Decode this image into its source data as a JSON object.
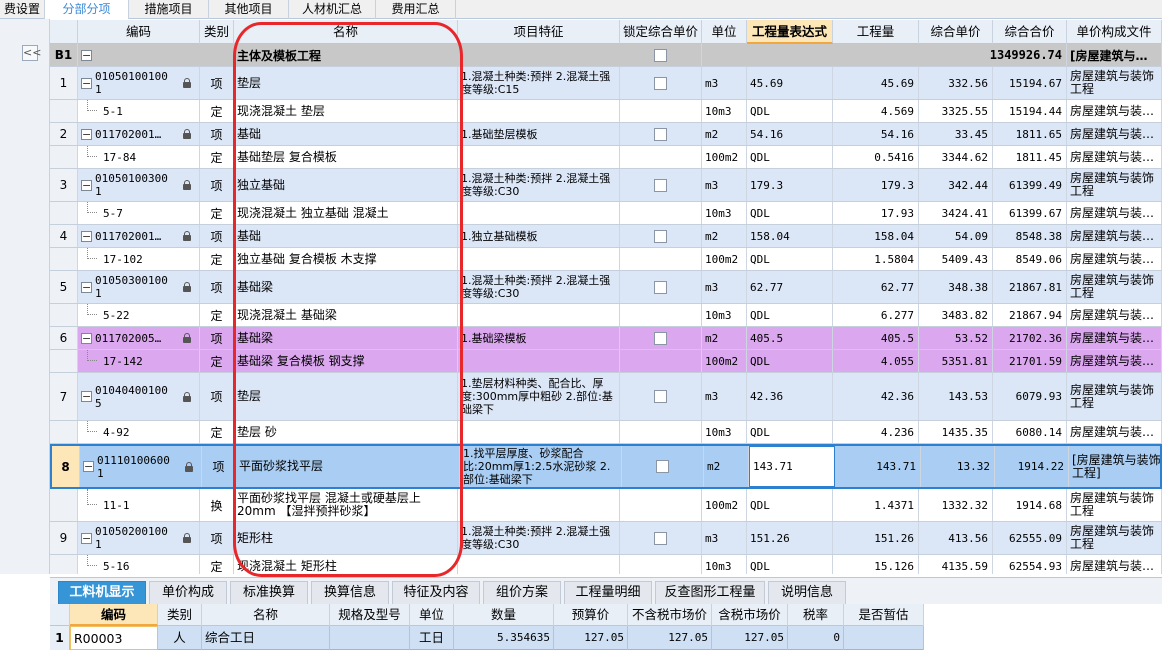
{
  "top_tabs": [
    {
      "label": "费设置",
      "active": false
    },
    {
      "label": "分部分项",
      "active": true
    },
    {
      "label": "措施项目",
      "active": false
    },
    {
      "label": "其他项目",
      "active": false
    },
    {
      "label": "人材机汇总",
      "active": false
    },
    {
      "label": "费用汇总",
      "active": false
    }
  ],
  "sidebar": {
    "collapse_label": "<<"
  },
  "columns": [
    "编码",
    "类别",
    "名称",
    "项目特征",
    "锁定综合单价",
    "单位",
    "工程量表达式",
    "工程量",
    "综合单价",
    "综合合价",
    "单价构成文件"
  ],
  "section": {
    "num": "B1",
    "name": "主体及模板工程",
    "total": "1349926.74",
    "file": "[房屋建筑与…"
  },
  "rows": [
    {
      "num": "1",
      "code": "01050100100 1",
      "type": "项",
      "name": "垫层",
      "feature": "1.混凝土种类:预拌 2.混凝土强度等级:C15",
      "unit": "m3",
      "expr": "45.69",
      "qty": "45.69",
      "price": "332.56",
      "total": "15194.67",
      "file": "房屋建筑与装饰工程"
    },
    {
      "num": "",
      "code": "5-1",
      "type": "定",
      "name": "现浇混凝土 垫层",
      "feature": "",
      "unit": "10m3",
      "expr": "QDL",
      "qty": "4.569",
      "price": "3325.55",
      "total": "15194.44",
      "file": "房屋建筑与装…"
    },
    {
      "num": "2",
      "code": "011702001…",
      "type": "项",
      "name": "基础",
      "feature": "1.基础垫层模板",
      "unit": "m2",
      "expr": "54.16",
      "qty": "54.16",
      "price": "33.45",
      "total": "1811.65",
      "file": "房屋建筑与装…"
    },
    {
      "num": "",
      "code": "17-84",
      "type": "定",
      "name": "基础垫层 复合模板",
      "feature": "",
      "unit": "100m2",
      "expr": "QDL",
      "qty": "0.5416",
      "price": "3344.62",
      "total": "1811.45",
      "file": "房屋建筑与装…"
    },
    {
      "num": "3",
      "code": "01050100300 1",
      "type": "项",
      "name": "独立基础",
      "feature": "1.混凝土种类:预拌 2.混凝土强度等级:C30",
      "unit": "m3",
      "expr": "179.3",
      "qty": "179.3",
      "price": "342.44",
      "total": "61399.49",
      "file": "房屋建筑与装饰工程"
    },
    {
      "num": "",
      "code": "5-7",
      "type": "定",
      "name": "现浇混凝土 独立基础 混凝土",
      "feature": "",
      "unit": "10m3",
      "expr": "QDL",
      "qty": "17.93",
      "price": "3424.41",
      "total": "61399.67",
      "file": "房屋建筑与装…"
    },
    {
      "num": "4",
      "code": "011702001…",
      "type": "项",
      "name": "基础",
      "feature": "1.独立基础模板",
      "unit": "m2",
      "expr": "158.04",
      "qty": "158.04",
      "price": "54.09",
      "total": "8548.38",
      "file": "房屋建筑与装…"
    },
    {
      "num": "",
      "code": "17-102",
      "type": "定",
      "name": "独立基础 复合模板 木支撑",
      "feature": "",
      "unit": "100m2",
      "expr": "QDL",
      "qty": "1.5804",
      "price": "5409.43",
      "total": "8549.06",
      "file": "房屋建筑与装…"
    },
    {
      "num": "5",
      "code": "01050300100 1",
      "type": "项",
      "name": "基础梁",
      "feature": "1.混凝土种类:预拌 2.混凝土强度等级:C30",
      "unit": "m3",
      "expr": "62.77",
      "qty": "62.77",
      "price": "348.38",
      "total": "21867.81",
      "file": "房屋建筑与装饰工程"
    },
    {
      "num": "",
      "code": "5-22",
      "type": "定",
      "name": "现浇混凝土 基础梁",
      "feature": "",
      "unit": "10m3",
      "expr": "QDL",
      "qty": "6.277",
      "price": "3483.82",
      "total": "21867.94",
      "file": "房屋建筑与装…"
    },
    {
      "num": "6",
      "code": "011702005…",
      "type": "项",
      "name": "基础梁",
      "feature": "1.基础梁模板",
      "unit": "m2",
      "expr": "405.5",
      "qty": "405.5",
      "price": "53.52",
      "total": "21702.36",
      "file": "房屋建筑与装…"
    },
    {
      "num": "",
      "code": "17-142",
      "type": "定",
      "name": "基础梁 复合模板 钢支撑",
      "feature": "",
      "unit": "100m2",
      "expr": "QDL",
      "qty": "4.055",
      "price": "5351.81",
      "total": "21701.59",
      "file": "房屋建筑与装…"
    },
    {
      "num": "7",
      "code": "01040400100 5",
      "type": "项",
      "name": "垫层",
      "feature": "1.垫层材料种类、配合比、厚度:300mm厚中粗砂 2.部位:基础梁下",
      "unit": "m3",
      "expr": "42.36",
      "qty": "42.36",
      "price": "143.53",
      "total": "6079.93",
      "file": "房屋建筑与装饰工程"
    },
    {
      "num": "",
      "code": "4-92",
      "type": "定",
      "name": "垫层 砂",
      "feature": "",
      "unit": "10m3",
      "expr": "QDL",
      "qty": "4.236",
      "price": "1435.35",
      "total": "6080.14",
      "file": "房屋建筑与装…"
    },
    {
      "num": "8",
      "code": "01110100600 1",
      "type": "项",
      "name": "平面砂浆找平层",
      "feature": "1.找平层厚度、砂浆配合比:20mm厚1:2.5水泥砂浆 2.部位:基础梁下",
      "unit": "m2",
      "expr": "143.71",
      "qty": "143.71",
      "price": "13.32",
      "total": "1914.22",
      "file": "[房屋建筑与装饰工程]"
    },
    {
      "num": "",
      "code": "11-1",
      "type": "换",
      "name": "平面砂浆找平层 混凝土或硬基层上 20mm 【湿拌预拌砂浆】",
      "feature": "",
      "unit": "100m2",
      "expr": "QDL",
      "qty": "1.4371",
      "price": "1332.32",
      "total": "1914.68",
      "file": "房屋建筑与装饰工程"
    },
    {
      "num": "9",
      "code": "01050200100 1",
      "type": "项",
      "name": "矩形柱",
      "feature": "1.混凝土种类:预拌 2.混凝土强度等级:C30",
      "unit": "m3",
      "expr": "151.26",
      "qty": "151.26",
      "price": "413.56",
      "total": "62555.09",
      "file": "房屋建筑与装饰工程"
    },
    {
      "num": "",
      "code": "5-16",
      "type": "定",
      "name": "现浇混凝土 矩形柱",
      "feature": "",
      "unit": "10m3",
      "expr": "QDL",
      "qty": "15.126",
      "price": "4135.59",
      "total": "62554.93",
      "file": "房屋建筑与装…"
    }
  ],
  "bottom_tabs": [
    "工料机显示",
    "单价构成",
    "标准换算",
    "换算信息",
    "特征及内容",
    "组价方案",
    "工程量明细",
    "反查图形工程量",
    "说明信息"
  ],
  "bottom_columns": [
    "编码",
    "类别",
    "名称",
    "规格及型号",
    "单位",
    "数量",
    "预算价",
    "不含税市场价",
    "含税市场价",
    "税率",
    "是否暂估"
  ],
  "bottom_row": {
    "num": "1",
    "code": "R00003",
    "type": "人",
    "name": "综合工日",
    "spec": "",
    "unit": "工日",
    "qty": "5.354635",
    "budget": "127.05",
    "market_ex": "127.05",
    "market_in": "127.05",
    "tax": "0",
    "est": ""
  },
  "colors": {
    "header": "#e9eff7",
    "section": "#c8c8c8",
    "item_row": "#dbe6f7",
    "purple_row": "#dba8ef",
    "selected_row": "#a9cdf3",
    "active_tab": "#3595d7",
    "annotation": "#e8272a"
  }
}
